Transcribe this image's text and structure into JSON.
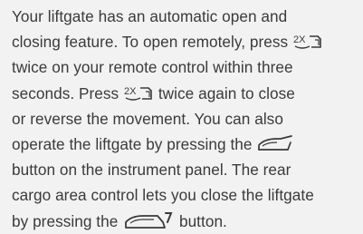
{
  "text": {
    "l1": "Your liftgate has an automatic open and",
    "l2a": "closing feature. To open remotely, press",
    "l3": "twice on your remote control within three",
    "l4a": "seconds. Press",
    "l4b": "twice again to close",
    "l5": "or reverse the movement. You can also",
    "l6a": "operate the liftgate by pressing the",
    "l7": "button on the instrument panel. The rear",
    "l8": "cargo area control lets you close the liftgate",
    "l9a": "by pressing the",
    "l9b": "button."
  },
  "icons": {
    "remote": "remote-2x-liftgate-icon",
    "panel": "liftgate-open-icon",
    "cargo": "liftgate-close-icon"
  }
}
